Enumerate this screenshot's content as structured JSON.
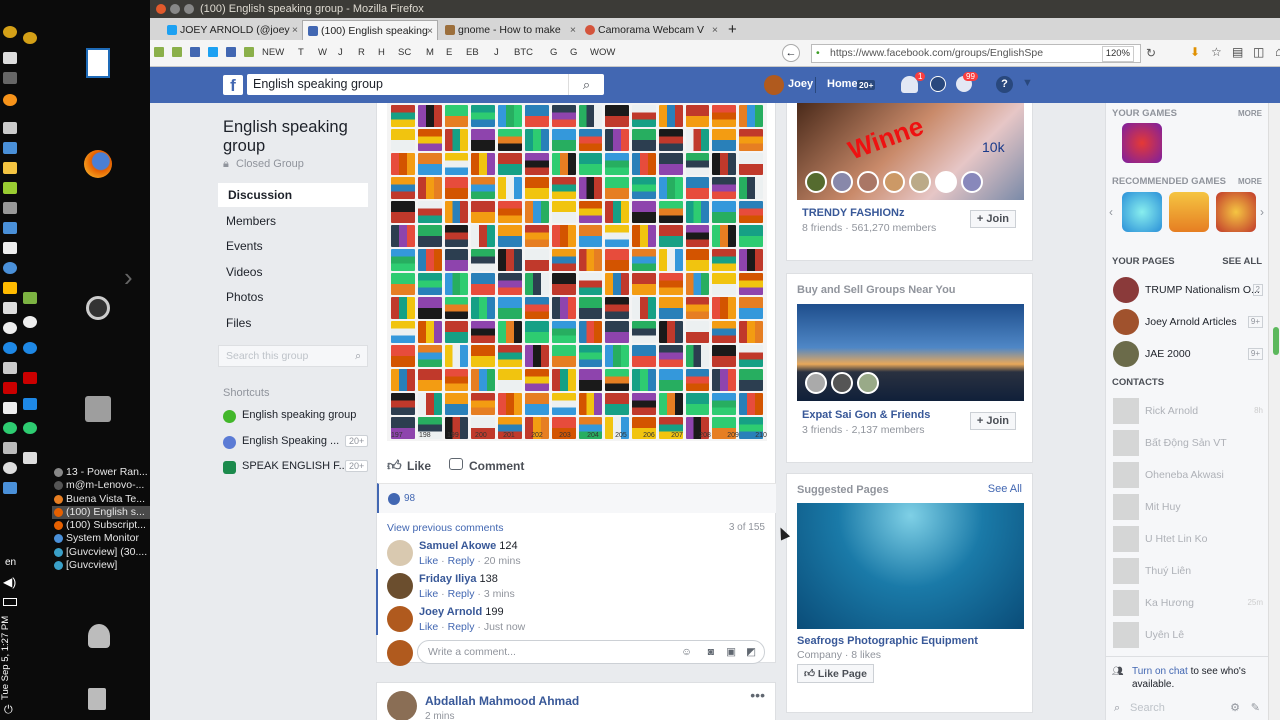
{
  "window": {
    "title": "(100) English speaking group - Mozilla Firefox"
  },
  "tabs": [
    {
      "label": "JOEY ARNOLD (@joey",
      "color": "#1da1f2"
    },
    {
      "label": "(100) English speaking",
      "color": "#4267b2"
    },
    {
      "label": "gnome - How to make",
      "color": "#9c6f3c"
    },
    {
      "label": "Camorama Webcam V",
      "color": "#d4543c"
    }
  ],
  "bookmarks": [
    "NEW",
    "T",
    "W",
    "J",
    "R",
    "H",
    "SC",
    "M",
    "E",
    "EB",
    "J",
    "BTC",
    "G",
    "G",
    "WOW"
  ],
  "url": "https://www.facebook.com/groups/EnglishSpe",
  "zoom": "120%",
  "fb_header": {
    "search": "English speaking group",
    "user": "Joey",
    "home": "Home",
    "home_badge": "20+",
    "friends_badge": "1",
    "notif_badge": "99"
  },
  "group": {
    "name": "English speaking group",
    "type": "Closed Group",
    "nav": [
      "Discussion",
      "Members",
      "Events",
      "Videos",
      "Photos",
      "Files"
    ],
    "search_placeholder": "Search this group",
    "shortcuts_title": "Shortcuts",
    "shortcuts": [
      {
        "label": "English speaking group",
        "count": "",
        "color": "#42b72a"
      },
      {
        "label": "English Speaking ...",
        "count": "20+",
        "color": "#5b7bd5"
      },
      {
        "label": "SPEAK ENGLISH F...",
        "count": "20+",
        "color": "#1b8a4c"
      }
    ]
  },
  "post": {
    "flag_numbers_last": [
      "197",
      "198",
      "199",
      "200",
      "201",
      "202",
      "203",
      "204",
      "205",
      "206",
      "207",
      "208",
      "209",
      "210"
    ],
    "like_label": "Like",
    "comment_label": "Comment",
    "reaction_count": "98",
    "view_previous": "View previous comments",
    "comment_count": "3 of 155",
    "comments": [
      {
        "name": "Samuel Akowe",
        "text": "124",
        "like": "Like",
        "reply": "Reply",
        "time": "20 mins",
        "color": "#d9c9b0"
      },
      {
        "name": "Friday Iliya",
        "text": "138",
        "like": "Like",
        "reply": "Reply",
        "time": "3 mins",
        "color": "#6b4e2e"
      },
      {
        "name": "Joey Arnold",
        "text": "199",
        "like": "Like",
        "reply": "Reply",
        "time": "Just now",
        "color": "#b05a1e"
      }
    ],
    "write_placeholder": "Write a comment...",
    "next_author": "Abdallah Mahmood Ahmad",
    "next_time": "2 mins"
  },
  "group_card": {
    "title": "TRENDY FASHIONz",
    "meta": "8 friends · 561,270 members",
    "join": "Join",
    "overlay_text": "Winne",
    "badge": "10k"
  },
  "buy_sell": {
    "header": "Buy and Sell Groups Near You",
    "title": "Expat Sai Gon & Friends",
    "meta": "3 friends · 2,137 members",
    "join": "Join"
  },
  "suggested": {
    "header": "Suggested Pages",
    "see_all": "See All",
    "title": "Seafrogs Photographic Equipment",
    "meta": "Company · 8 likes",
    "like_page": "Like Page"
  },
  "right": {
    "games_title": "YOUR GAMES",
    "more": "MORE",
    "recommended_title": "RECOMMENDED GAMES",
    "pages_title": "YOUR PAGES",
    "see_all": "SEE ALL",
    "pages": [
      {
        "name": "TRUMP Nationalism O...",
        "count": "2",
        "color": "#8a3a3a"
      },
      {
        "name": "Joey Arnold Articles",
        "count": "9+",
        "color": "#a0522d"
      },
      {
        "name": "JAE 2000",
        "count": "9+",
        "color": "#6b6b4a"
      }
    ],
    "contacts_title": "CONTACTS",
    "contacts": [
      {
        "name": "Rick Arnold",
        "time": "8h"
      },
      {
        "name": "Bất Động Sản VT",
        "time": ""
      },
      {
        "name": "Oheneba Akwasi",
        "time": ""
      },
      {
        "name": "Mit Huy",
        "time": ""
      },
      {
        "name": "U Htet Lin Ko",
        "time": ""
      },
      {
        "name": "Thuý Liên",
        "time": ""
      },
      {
        "name": "Ka Hương",
        "time": "25m"
      },
      {
        "name": "Uyên Lê",
        "time": ""
      }
    ],
    "chat_link": "Turn on chat",
    "chat_rest": "to see who's available.",
    "chat_search": "Search"
  },
  "taskbar": {
    "windows": [
      {
        "label": "13 - Power Ran...",
        "color": "#888"
      },
      {
        "label": "m@m-Lenovo-...",
        "color": "#555"
      },
      {
        "label": "Buena Vista Te...",
        "color": "#e67e22"
      },
      {
        "label": "(100) English s...",
        "color": "#e66000"
      },
      {
        "label": "(100) Subscript...",
        "color": "#e66000"
      },
      {
        "label": "System Monitor",
        "color": "#4a90d9"
      },
      {
        "label": "[Guvcview] (30....",
        "color": "#3aa0c8"
      },
      {
        "label": "[Guvcview]",
        "color": "#3aa0c8"
      }
    ],
    "lang": "en",
    "clock": "Tue Sep 5, 1:27 PM"
  }
}
